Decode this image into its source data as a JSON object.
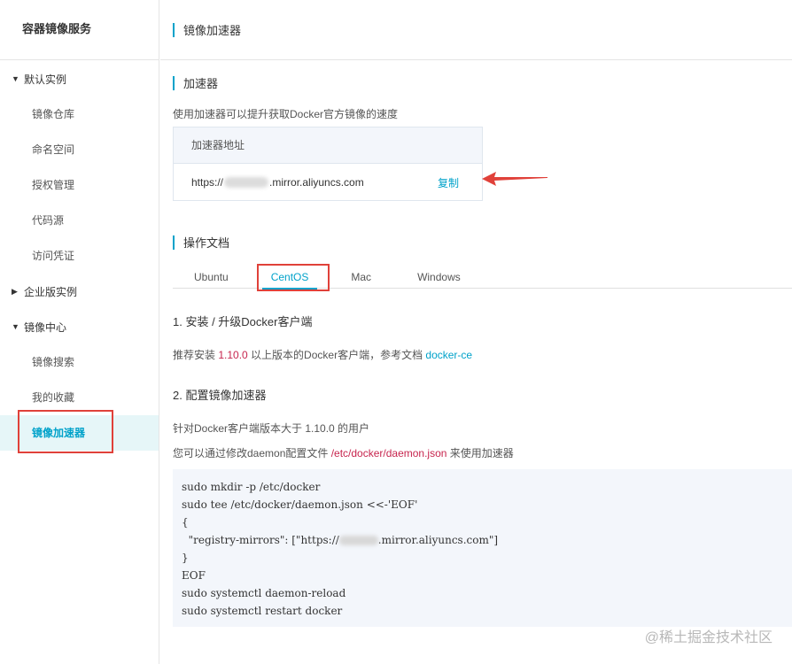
{
  "sidebar": {
    "title": "容器镜像服务",
    "groups": [
      {
        "label": "默认实例",
        "expanded": true,
        "items": [
          "镜像仓库",
          "命名空间",
          "授权管理",
          "代码源",
          "访问凭证"
        ]
      },
      {
        "label": "企业版实例",
        "expanded": false,
        "items": []
      },
      {
        "label": "镜像中心",
        "expanded": true,
        "items": [
          "镜像搜索",
          "我的收藏",
          "镜像加速器"
        ]
      }
    ],
    "active_item": "镜像加速器"
  },
  "header": {
    "title": "镜像加速器"
  },
  "accelerator": {
    "section_title": "加速器",
    "description": "使用加速器可以提升获取Docker官方镜像的速度",
    "table_header": "加速器地址",
    "url_prefix": "https://",
    "url_suffix": ".mirror.aliyuncs.com",
    "copy_label": "复制"
  },
  "docs": {
    "section_title": "操作文档",
    "tabs": [
      "Ubuntu",
      "CentOS",
      "Mac",
      "Windows"
    ],
    "active_tab": "CentOS",
    "step1": {
      "title": "1. 安装 / 升级Docker客户端",
      "text_before": "推荐安装 ",
      "version": "1.10.0",
      "text_after": " 以上版本的Docker客户端，参考文档 ",
      "link": "docker-ce"
    },
    "step2": {
      "title": "2. 配置镜像加速器",
      "line1": "针对Docker客户端版本大于 1.10.0 的用户",
      "line2_before": "您可以通过修改daemon配置文件 ",
      "config_path": "/etc/docker/daemon.json",
      "line2_after": " 来使用加速器"
    },
    "code": {
      "l1": "sudo mkdir -p /etc/docker",
      "l2": "sudo tee /etc/docker/daemon.json <<-'EOF'",
      "l3": "{",
      "l4a": "  \"registry-mirrors\": [\"https://",
      "l4b": ".mirror.aliyuncs.com\"]",
      "l5": "}",
      "l6": "EOF",
      "l7": "sudo systemctl daemon-reload",
      "l8": "sudo systemctl restart docker"
    }
  },
  "watermark": "@稀土掘金技术社区",
  "colors": {
    "accent": "#00a2ca",
    "highlight_box": "#e0413a",
    "code_red": "#c7254e"
  }
}
